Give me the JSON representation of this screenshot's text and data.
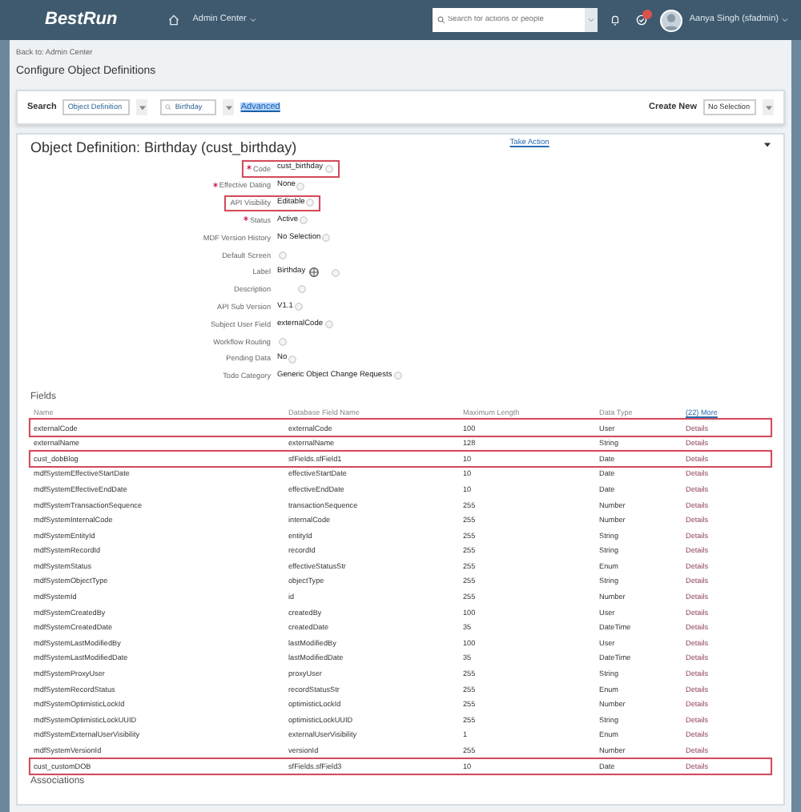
{
  "header": {
    "logo": "BestRun",
    "nav_label": "Admin Center",
    "search": {
      "placeholder": "Search for actions or people"
    },
    "user_name": "Aanya Singh (sfadmin)"
  },
  "breadcrumb": "Back to: Admin Center",
  "page_title": "Configure Object Definitions",
  "search_bar": {
    "label": "Search",
    "type_select": "Object Definition",
    "query": "Birthday",
    "advanced_link": "Advanced",
    "create_label": "Create New",
    "create_select": "No Selection"
  },
  "definition": {
    "title": "Object Definition: Birthday (cust_birthday)",
    "action": "Take Action",
    "properties": [
      {
        "label": "Code",
        "value": "cust_birthday",
        "required": true,
        "highlighted": true,
        "kind": "plain"
      },
      {
        "label": "Effective Dating",
        "value": "None",
        "required": true,
        "highlighted": false,
        "kind": "plain"
      },
      {
        "label": "API Visibility",
        "value": "Editable",
        "required": false,
        "highlighted": true,
        "kind": "plain"
      },
      {
        "label": "Status",
        "value": "Active",
        "required": true,
        "highlighted": false,
        "kind": "plain"
      },
      {
        "label": "MDF Version History",
        "value": "No Selection",
        "required": false,
        "highlighted": false,
        "kind": "plain"
      },
      {
        "label": "Default Screen",
        "required": false,
        "highlighted": false,
        "kind": "plain"
      },
      {
        "label": "Label",
        "value": "Birthday",
        "required": false,
        "highlighted": false,
        "kind": "translatable"
      },
      {
        "label": "Description",
        "required": false,
        "highlighted": false,
        "kind": "translatable_empty"
      },
      {
        "label": "API Sub Version",
        "value": "V1.1",
        "required": false,
        "highlighted": false,
        "kind": "plain"
      },
      {
        "label": "Subject User Field",
        "value": "externalCode",
        "required": false,
        "highlighted": false,
        "kind": "plain"
      },
      {
        "label": "Workflow Routing",
        "required": false,
        "highlighted": false,
        "kind": "plain"
      },
      {
        "label": "Pending Data",
        "value": "No",
        "required": false,
        "highlighted": false,
        "kind": "plain"
      },
      {
        "label": "Todo Category",
        "value": "Generic Object Change Requests",
        "required": false,
        "highlighted": false,
        "kind": "plain"
      }
    ],
    "fields": {
      "title": "Fields",
      "columns": [
        "Name",
        "Database Field Name",
        "Maximum Length",
        "Data Type"
      ],
      "more_link": "(22) More",
      "rows": [
        {
          "name": "externalCode",
          "db": "externalCode",
          "max": "100",
          "type": "User",
          "link": "Details",
          "highlighted": true
        },
        {
          "name": "externalName",
          "db": "externalName",
          "max": "128",
          "type": "String",
          "link": "Details",
          "highlighted": false
        },
        {
          "name": "cust_dobBlog",
          "db": "sfFields.sfField1",
          "max": "10",
          "type": "Date",
          "link": "Details",
          "highlighted": true
        },
        {
          "name": "mdfSystemEffectiveStartDate",
          "db": "effectiveStartDate",
          "max": "10",
          "type": "Date",
          "link": "Details",
          "highlighted": false
        },
        {
          "name": "mdfSystemEffectiveEndDate",
          "db": "effectiveEndDate",
          "max": "10",
          "type": "Date",
          "link": "Details",
          "highlighted": false
        },
        {
          "name": "mdfSystemTransactionSequence",
          "db": "transactionSequence",
          "max": "255",
          "type": "Number",
          "link": "Details",
          "highlighted": false
        },
        {
          "name": "mdfSystemInternalCode",
          "db": "internalCode",
          "max": "255",
          "type": "Number",
          "link": "Details",
          "highlighted": false
        },
        {
          "name": "mdfSystemEntityId",
          "db": "entityId",
          "max": "255",
          "type": "String",
          "link": "Details",
          "highlighted": false
        },
        {
          "name": "mdfSystemRecordId",
          "db": "recordId",
          "max": "255",
          "type": "String",
          "link": "Details",
          "highlighted": false
        },
        {
          "name": "mdfSystemStatus",
          "db": "effectiveStatusStr",
          "max": "255",
          "type": "Enum",
          "link": "Details",
          "highlighted": false
        },
        {
          "name": "mdfSystemObjectType",
          "db": "objectType",
          "max": "255",
          "type": "String",
          "link": "Details",
          "highlighted": false
        },
        {
          "name": "mdfSystemId",
          "db": "id",
          "max": "255",
          "type": "Number",
          "link": "Details",
          "highlighted": false
        },
        {
          "name": "mdfSystemCreatedBy",
          "db": "createdBy",
          "max": "100",
          "type": "User",
          "link": "Details",
          "highlighted": false
        },
        {
          "name": "mdfSystemCreatedDate",
          "db": "createdDate",
          "max": "35",
          "type": "DateTime",
          "link": "Details",
          "highlighted": false
        },
        {
          "name": "mdfSystemLastModifiedBy",
          "db": "lastModifiedBy",
          "max": "100",
          "type": "User",
          "link": "Details",
          "highlighted": false
        },
        {
          "name": "mdfSystemLastModifiedDate",
          "db": "lastModifiedDate",
          "max": "35",
          "type": "DateTime",
          "link": "Details",
          "highlighted": false
        },
        {
          "name": "mdfSystemProxyUser",
          "db": "proxyUser",
          "max": "255",
          "type": "String",
          "link": "Details",
          "highlighted": false
        },
        {
          "name": "mdfSystemRecordStatus",
          "db": "recordStatusStr",
          "max": "255",
          "type": "Enum",
          "link": "Details",
          "highlighted": false
        },
        {
          "name": "mdfSystemOptimisticLockId",
          "db": "optimisticLockId",
          "max": "255",
          "type": "Number",
          "link": "Details",
          "highlighted": false
        },
        {
          "name": "mdfSystemOptimisticLockUUID",
          "db": "optimisticLockUUID",
          "max": "255",
          "type": "String",
          "link": "Details",
          "highlighted": false
        },
        {
          "name": "mdfSystemExternalUserVisibility",
          "db": "externalUserVisibility",
          "max": "1",
          "type": "Enum",
          "link": "Details",
          "highlighted": false
        },
        {
          "name": "mdfSystemVersionId",
          "db": "versionId",
          "max": "255",
          "type": "Number",
          "link": "Details",
          "highlighted": false
        },
        {
          "name": "cust_customDOB",
          "db": "sfFields.sfField3",
          "max": "10",
          "type": "Date",
          "link": "Details",
          "highlighted": true
        }
      ]
    },
    "associations_title": "Associations"
  }
}
